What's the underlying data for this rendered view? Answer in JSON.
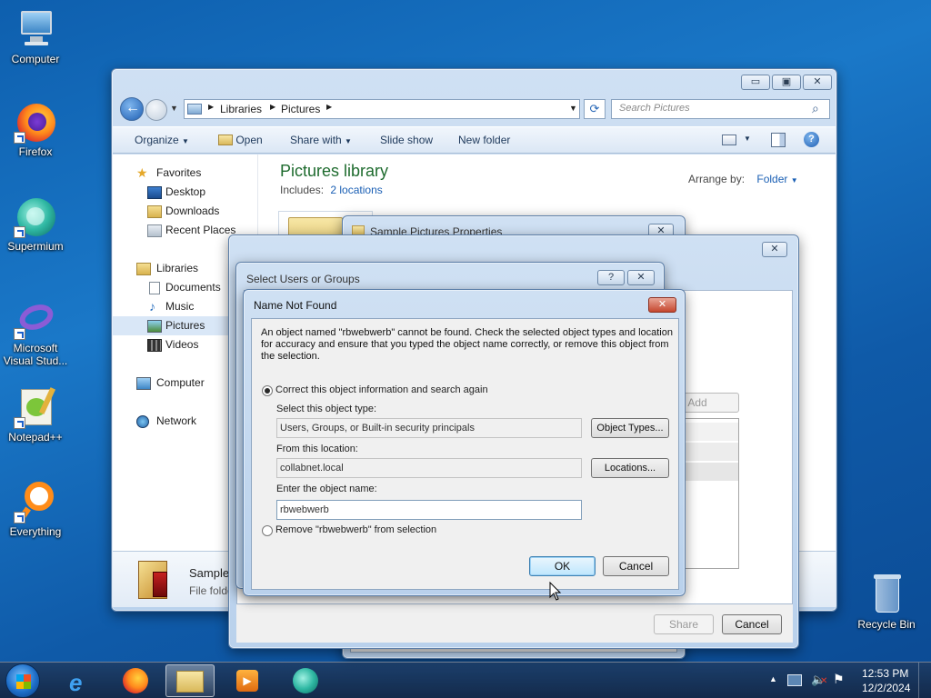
{
  "desktop": {
    "icons": [
      {
        "label": "Computer"
      },
      {
        "label": "Firefox"
      },
      {
        "label": "Supermium"
      },
      {
        "label": "Microsoft Visual Stud..."
      },
      {
        "label": "Notepad++"
      },
      {
        "label": "Everything"
      },
      {
        "label": "Recycle Bin"
      }
    ]
  },
  "explorer": {
    "breadcrumb": [
      "Libraries",
      "Pictures"
    ],
    "search_placeholder": "Search Pictures",
    "toolbar": {
      "organize": "Organize",
      "open": "Open",
      "share_with": "Share with",
      "slide_show": "Slide show",
      "new_folder": "New folder"
    },
    "sidebar": {
      "favorites": "Favorites",
      "favorites_items": [
        "Desktop",
        "Downloads",
        "Recent Places"
      ],
      "libraries": "Libraries",
      "libraries_items": [
        "Documents",
        "Music",
        "Pictures",
        "Videos"
      ],
      "computer": "Computer",
      "network": "Network"
    },
    "library_title": "Pictures library",
    "includes_label": "Includes:",
    "includes_link": "2 locations",
    "arrange_label": "Arrange by:",
    "arrange_value": "Folder",
    "details_name": "Sample",
    "details_type": "File folde"
  },
  "properties_dialog": {
    "title": "Sample Pictures Properties",
    "add_label": "Add",
    "share_label": "Share",
    "cancel_label": "Cancel"
  },
  "select_users_dialog": {
    "title": "Select Users or Groups",
    "help_glyph": "?",
    "close_glyph": "✕"
  },
  "name_not_found": {
    "title": "Name Not Found",
    "message": "An object named \"rbwebwerb\" cannot be found. Check the selected object types and location for accuracy and ensure that you typed the object name correctly, or remove this object from the selection.",
    "option_correct": "Correct this object information and search again",
    "object_type_label": "Select this object type:",
    "object_type_value": "Users, Groups, or Built-in security principals",
    "object_types_button": "Object Types...",
    "location_label": "From this location:",
    "location_value": "collabnet.local",
    "locations_button": "Locations...",
    "object_name_label": "Enter the object name:",
    "object_name_value": "rbwebwerb",
    "option_remove": "Remove \"rbwebwerb\" from selection",
    "ok_button": "OK",
    "cancel_button": "Cancel"
  },
  "taskbar": {
    "time": "12:53 PM",
    "date": "12/2/2024"
  }
}
